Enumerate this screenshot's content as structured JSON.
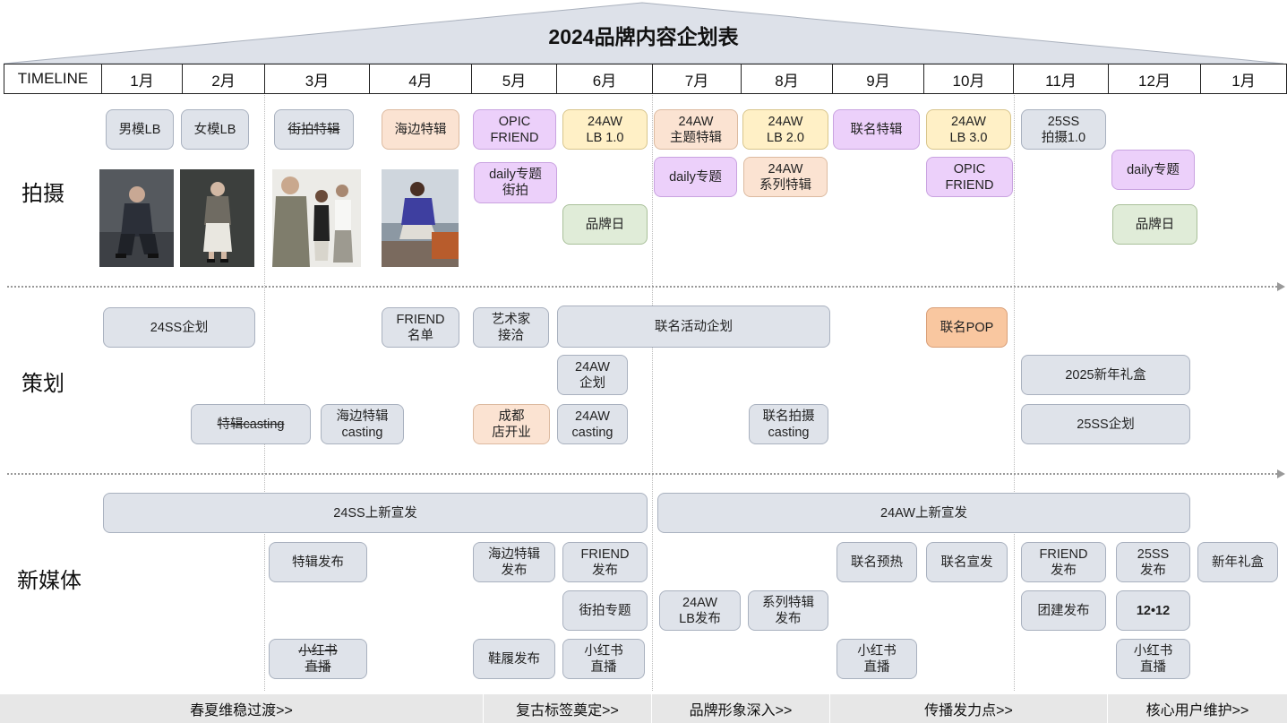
{
  "title": "2024品牌内容企划表",
  "timeline": [
    "TIMELINE",
    "1月",
    "2月",
    "3月",
    "4月",
    "5月",
    "6月",
    "7月",
    "8月",
    "9月",
    "10月",
    "11月",
    "12月",
    "1月"
  ],
  "sections": {
    "shoot": "拍摄",
    "plan": "策划",
    "media": "新媒体"
  },
  "shoot": {
    "male_lb": "男模LB",
    "female_lb": "女模LB",
    "street": "街拍特辑",
    "beach": "海边特辑",
    "opic_may": "OPIC\nFRIEND",
    "aw_lb1": "24AW\nLB 1.0",
    "aw_theme": "24AW\n主题特辑",
    "aw_lb2": "24AW\nLB 2.0",
    "collab": "联名特辑",
    "aw_lb3": "24AW\nLB 3.0",
    "ss25": "25SS\n拍摄1.0",
    "daily_street": "daily专题\n街拍",
    "daily_jul": "daily专题",
    "aw_series": "24AW\n系列特辑",
    "opic_oct": "OPIC\nFRIEND",
    "daily_dec": "daily专题",
    "brand_day_jun": "品牌日",
    "brand_day_dec": "品牌日"
  },
  "plan": {
    "ss24": "24SS企划",
    "friend_list": "FRIEND\n名单",
    "artist": "艺术家\n接洽",
    "collab_activity": "联名活动企划",
    "collab_pop": "联名POP",
    "aw_plan": "24AW\n企划",
    "gift_box": "2025新年礼盒",
    "special_casting": "特辑casting",
    "beach_casting": "海边特辑\ncasting",
    "chengdu": "成都\n店开业",
    "aw_casting": "24AW\ncasting",
    "collab_casting": "联名拍摄\ncasting",
    "ss25_plan": "25SS企划"
  },
  "media": {
    "ss24_launch": "24SS上新宣发",
    "aw24_launch": "24AW上新宣发",
    "special_release": "特辑发布",
    "beach_release": "海边特辑\n发布",
    "friend_release_jun": "FRIEND\n发布",
    "collab_warmup": "联名预热",
    "collab_promo": "联名宣发",
    "friend_release_nov": "FRIEND\n发布",
    "ss25_release": "25SS\n发布",
    "new_year_gift": "新年礼盒",
    "street_topic": "街拍专题",
    "aw_lb_release": "24AW\nLB发布",
    "series_release": "系列特辑\n发布",
    "team_release": "团建发布",
    "d1212": "12•12",
    "xhs_mar": "小红书\n直播",
    "shoes": "鞋履发布",
    "xhs_jun": "小红书\n直播",
    "xhs_sep": "小红书\n直播",
    "xhs_dec": "小红书\n直播"
  },
  "phases": [
    "春夏维稳过渡>>",
    "复古标签奠定>>",
    "品牌形象深入>>",
    "传播发力点>>",
    "核心用户维护>>"
  ]
}
